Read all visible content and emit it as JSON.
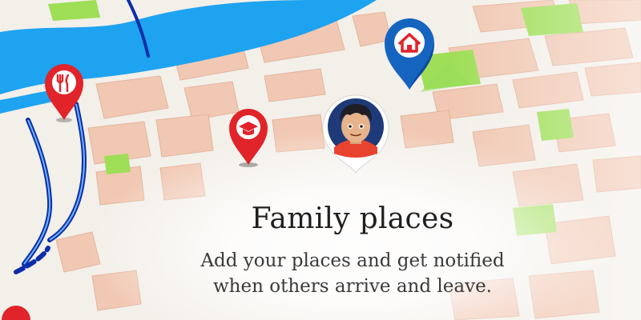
{
  "banner": {
    "title": "Family places",
    "subtitle_line1": "Add your places and get notified",
    "subtitle_line2": "when others arrive and leave."
  },
  "map": {
    "colors": {
      "water": "#1ea3f0",
      "block": "#f1c8b3",
      "park": "#9fde57",
      "road": "#f5f3ef",
      "route": "#0b2ea8"
    }
  },
  "pins": [
    {
      "icon": "food-icon",
      "color": "#e0242a"
    },
    {
      "icon": "school-icon",
      "color": "#e0242a"
    },
    {
      "icon": "home-icon",
      "color": "#1565c0"
    },
    {
      "icon": "person-avatar",
      "color": "#ffffff"
    }
  ]
}
